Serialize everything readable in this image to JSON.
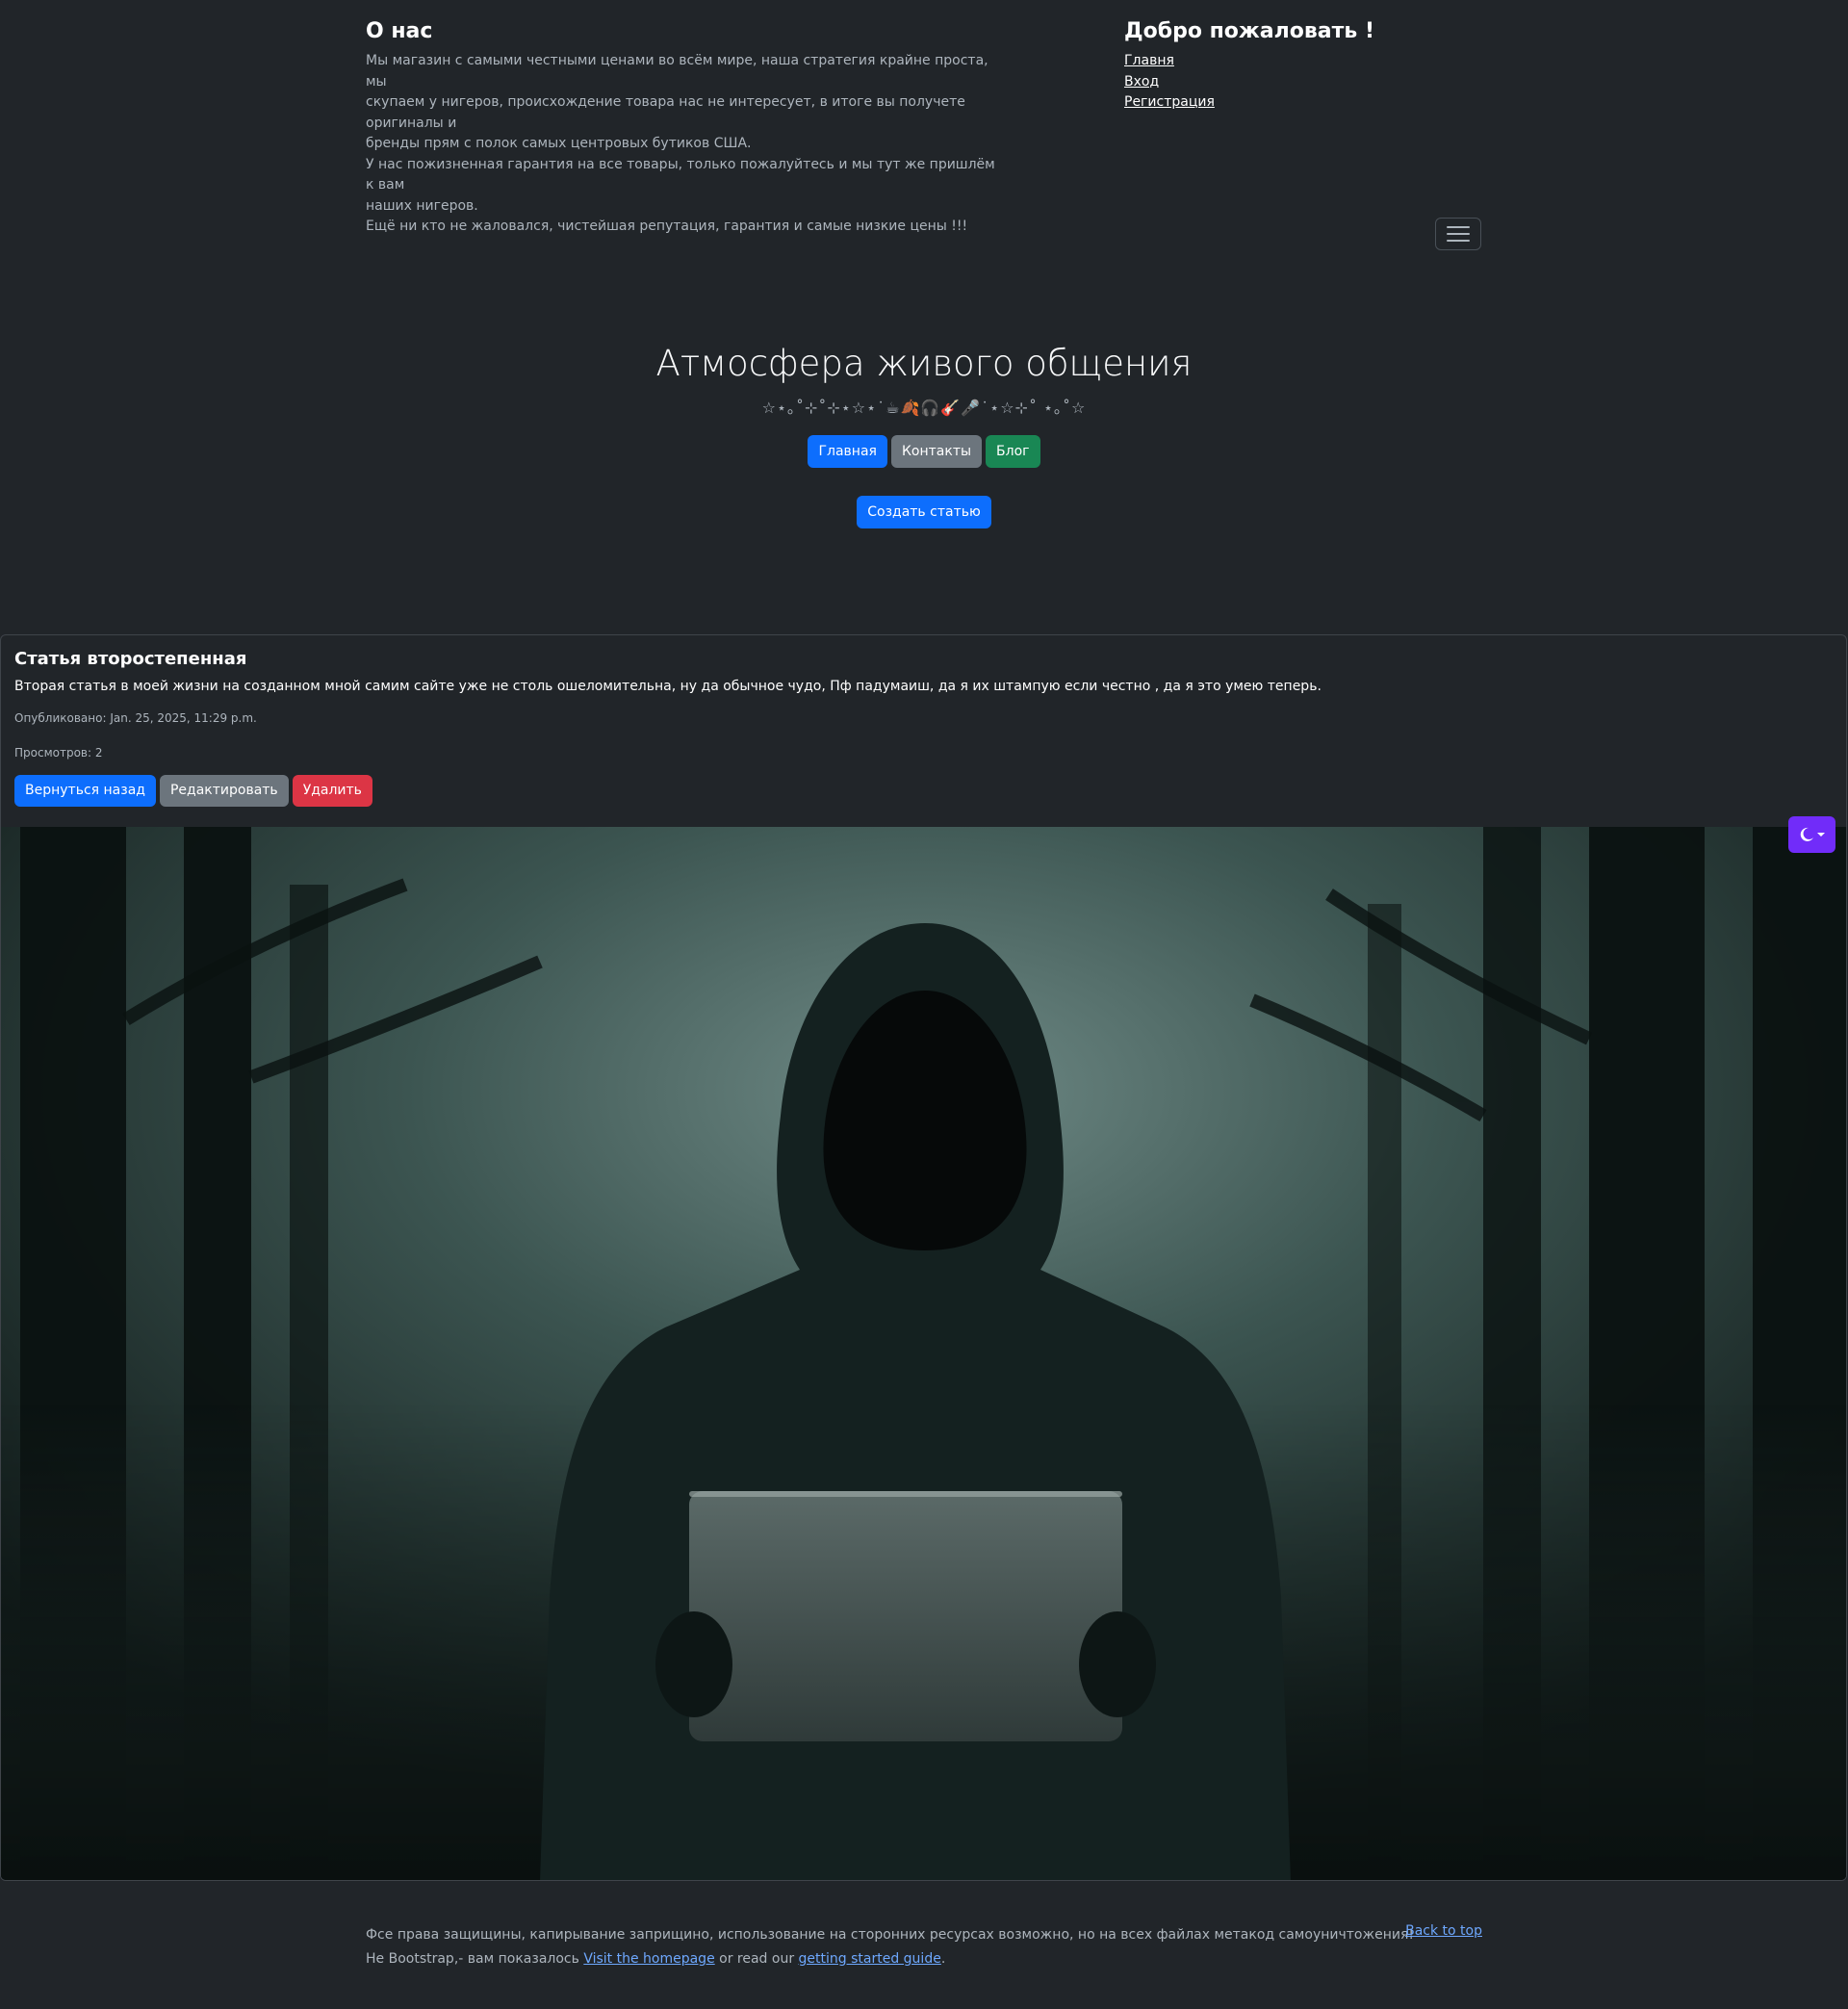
{
  "about": {
    "title": "О нас",
    "lines": [
      "Мы магазин с самыми честными ценами во всём мире, наша стратегия крайне проста, мы",
      "скупаем у нигеров, происхождение товара нас не интересует, в итоге вы получете оригиналы и",
      "бренды прям с полок самых центровых бутиков США.",
      "У нас пожизненная гарантия на все товары, только пожалуйтесь и мы тут же пришлём к вам",
      "наших нигеров.",
      "Ещё ни кто не жаловался, чистейшая репутация, гарантия и самые низкие цены !!!"
    ]
  },
  "welcome": {
    "title": "Добро пожаловать !",
    "links": [
      "Главня",
      "Вход",
      "Регистрация"
    ]
  },
  "hero": {
    "title": "Атмосфера живого общения",
    "decoration": "☆⋆｡˚⊹˚⊹⋆☆⋆˙☕🍂🎧🎸🎤˙⋆☆⊹˚ ⋆｡˚☆",
    "buttons": [
      "Главная",
      "Контакты",
      "Блог"
    ],
    "create_button": "Создать статью"
  },
  "article": {
    "title": "Статья второстепенная",
    "text": "Вторая статья в моей жизни на созданном мной самим сайте уже не столь ошеломительна, ну да обычное чудо, Пф падумаиш, да я их штампую если честно , да я это умею теперь.",
    "published": "Опубликовано: Jan. 25, 2025, 11:29 p.m.",
    "views": "Просмотров: 2",
    "back_button": "Вернуться назад",
    "edit_button": "Редактировать",
    "delete_button": "Удалить"
  },
  "footer": {
    "line1": "Фсе права защищины, капирывание заприщино, использование на сторонних ресурсах возможно, но на всех файлах метакод самоуничтожения!",
    "line2_prefix": "Не Bootstrap,- вам показалось ",
    "line2_link1": "Visit the homepage",
    "line2_middle": " or read our ",
    "line2_link2": "getting started guide",
    "line2_suffix": ".",
    "back_to_top": "Back to top"
  },
  "colors": {
    "background": "#212529",
    "primary": "#0d6efd",
    "secondary": "#6c757d",
    "success": "#198754",
    "danger": "#dc3545",
    "theme_toggle": "#712cf9"
  },
  "icons": {
    "menu": "hamburger-icon",
    "theme": "moon-icon",
    "dropdown": "caret-down-icon"
  }
}
